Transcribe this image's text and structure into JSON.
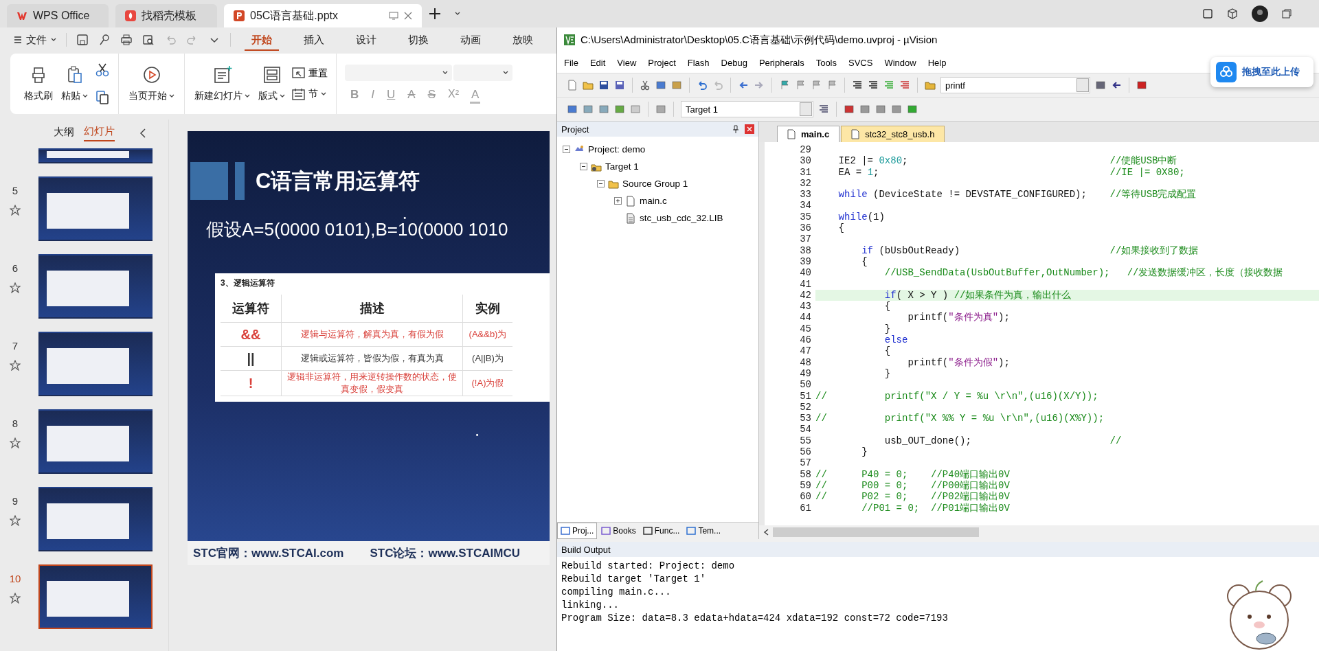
{
  "wps": {
    "tabs": [
      {
        "label": "WPS Office",
        "kind": "home",
        "selected": false
      },
      {
        "label": "找稻壳模板",
        "kind": "template",
        "selected": false
      },
      {
        "label": "05C语言基础.pptx",
        "kind": "presentation",
        "selected": true
      }
    ],
    "file_menu": "文件",
    "ribbon_tabs": [
      {
        "label": "开始",
        "selected": true
      },
      {
        "label": "插入",
        "selected": false
      },
      {
        "label": "设计",
        "selected": false
      },
      {
        "label": "切换",
        "selected": false
      },
      {
        "label": "动画",
        "selected": false
      },
      {
        "label": "放映",
        "selected": false
      }
    ],
    "ribbon": {
      "format_painter": "格式刷",
      "paste": "粘贴",
      "play_current": "当页开始",
      "new_slide": "新建幻灯片",
      "layout": "版式",
      "reset": "重置",
      "section": "节"
    },
    "format_buttons": [
      {
        "label": "B",
        "kind": "bold"
      },
      {
        "label": "I",
        "kind": "italic"
      },
      {
        "label": "U",
        "kind": "underline"
      },
      {
        "label": "A",
        "kind": "strike"
      },
      {
        "label": "S",
        "kind": "double-strike"
      },
      {
        "label": "X²",
        "kind": "superscript"
      },
      {
        "label": "A",
        "kind": "font-color"
      }
    ],
    "panel_tabs": [
      {
        "label": "大纲",
        "selected": false
      },
      {
        "label": "幻灯片",
        "selected": true
      }
    ],
    "thumbnails": [
      {
        "kind": "cut",
        "selected": false
      },
      {
        "kind": "full",
        "number": "5",
        "selected": false
      },
      {
        "kind": "full",
        "number": "6",
        "selected": false
      },
      {
        "kind": "full",
        "number": "7",
        "selected": false
      },
      {
        "kind": "full",
        "number": "8",
        "selected": false
      },
      {
        "kind": "full",
        "number": "9",
        "selected": false
      },
      {
        "kind": "full",
        "number": "10",
        "selected": true
      }
    ],
    "slide": {
      "title": "C语言常用运算符",
      "assumption": "假设A=5(0000 0101),B=10(0000 1010",
      "table_caption": "3、逻辑运算符",
      "columns": [
        "运算符",
        "描述",
        "实例"
      ],
      "rows": [
        {
          "operator": "&&",
          "description": "逻辑与运算符，解真为真，有假为假",
          "example": "(A&&b)为",
          "color": "#d9403a"
        },
        {
          "operator": "||",
          "description": "逻辑或运算符，皆假为假，有真为真",
          "example": "(A||B)为",
          "color": "#333333"
        },
        {
          "operator": "!",
          "description": "逻辑非运算符，用来逆转操作数的状态，使真变假，假变真",
          "example": "(!A)为假",
          "color": "#d9403a"
        }
      ],
      "footer": [
        "STC官网：www.STCAI.com",
        "STC论坛：www.STCAIMCU"
      ]
    }
  },
  "uvision": {
    "title": "C:\\Users\\Administrator\\Desktop\\05.C语言基础\\示例代码\\demo.uvproj - µVision",
    "menu": [
      "File",
      "Edit",
      "View",
      "Project",
      "Flash",
      "Debug",
      "Peripherals",
      "Tools",
      "SVCS",
      "Window",
      "Help"
    ],
    "find_combo": "printf",
    "target_combo": "Target 1",
    "project_title": "Project",
    "tree": [
      {
        "label": "Project: demo",
        "kind": "project",
        "expanded": true,
        "children": [
          {
            "label": "Target 1",
            "kind": "target",
            "expanded": true,
            "children": [
              {
                "label": "Source Group 1",
                "kind": "group",
                "expanded": true,
                "children": [
                  {
                    "label": "main.c",
                    "kind": "file",
                    "expanded": false
                  },
                  {
                    "label": "stc_usb_cdc_32.LIB",
                    "kind": "lib"
                  }
                ]
              }
            ]
          }
        ]
      }
    ],
    "panel_tabs": [
      {
        "label": "Proj...",
        "kind": "project",
        "selected": true
      },
      {
        "label": "Books",
        "kind": "books",
        "selected": false
      },
      {
        "label": "Func...",
        "kind": "functions",
        "selected": false
      },
      {
        "label": "Tem...",
        "kind": "templates",
        "selected": false
      }
    ],
    "file_tabs": [
      {
        "label": "main.c",
        "selected": true
      },
      {
        "label": "stc32_stc8_usb.h",
        "selected": false
      }
    ],
    "code": [
      {
        "num": "29",
        "current": false
      },
      {
        "num": "30",
        "current": false,
        "segs": [
          {
            "kind": "plain",
            "text": "    IE2 |= "
          },
          {
            "kind": "number",
            "text": "0x80"
          },
          {
            "kind": "plain",
            "text": ";                                   "
          },
          {
            "kind": "comment",
            "text": "//使能USB中断"
          }
        ]
      },
      {
        "num": "31",
        "current": false,
        "segs": [
          {
            "kind": "plain",
            "text": "    EA = "
          },
          {
            "kind": "number",
            "text": "1"
          },
          {
            "kind": "plain",
            "text": ";                                        "
          },
          {
            "kind": "comment",
            "text": "//IE |= 0X80;"
          }
        ]
      },
      {
        "num": "32",
        "current": false
      },
      {
        "num": "33",
        "current": false,
        "segs": [
          {
            "kind": "keyword",
            "text": "    while"
          },
          {
            "kind": "plain",
            "text": " (DeviceState != DEVSTATE_CONFIGURED);    "
          },
          {
            "kind": "comment",
            "text": "//等待USB完成配置"
          }
        ]
      },
      {
        "num": "34",
        "current": false
      },
      {
        "num": "35",
        "current": false,
        "segs": [
          {
            "kind": "keyword",
            "text": "    while"
          },
          {
            "kind": "plain",
            "text": "(1)"
          }
        ]
      },
      {
        "num": "36",
        "current": false,
        "segs": [
          {
            "kind": "plain",
            "text": "    {"
          }
        ]
      },
      {
        "num": "37",
        "current": false
      },
      {
        "num": "38",
        "current": false,
        "segs": [
          {
            "kind": "keyword",
            "text": "        if"
          },
          {
            "kind": "plain",
            "text": " (bUsbOutReady)                          "
          },
          {
            "kind": "comment",
            "text": "//如果接收到了数据"
          }
        ]
      },
      {
        "num": "39",
        "current": false,
        "segs": [
          {
            "kind": "plain",
            "text": "        {"
          }
        ]
      },
      {
        "num": "40",
        "current": false,
        "segs": [
          {
            "kind": "comment",
            "text": "            //USB_SendData(UsbOutBuffer,OutNumber);   //发送数据缓冲区，长度（接收数据"
          }
        ]
      },
      {
        "num": "41",
        "current": false
      },
      {
        "num": "42",
        "current": true,
        "segs": [
          {
            "kind": "keyword",
            "text": "            if"
          },
          {
            "kind": "plain",
            "text": "( X > Y ) "
          },
          {
            "kind": "comment",
            "text": "//如果条件为真，输出什么"
          }
        ]
      },
      {
        "num": "43",
        "current": false,
        "segs": [
          {
            "kind": "plain",
            "text": "            {"
          }
        ]
      },
      {
        "num": "44",
        "current": false,
        "segs": [
          {
            "kind": "plain",
            "text": "                printf("
          },
          {
            "kind": "string",
            "text": "\"条件为真\""
          },
          {
            "kind": "plain",
            "text": ");"
          }
        ]
      },
      {
        "num": "45",
        "current": false,
        "segs": [
          {
            "kind": "plain",
            "text": "            }"
          }
        ]
      },
      {
        "num": "46",
        "current": false,
        "segs": [
          {
            "kind": "keyword",
            "text": "            else"
          }
        ]
      },
      {
        "num": "47",
        "current": false,
        "segs": [
          {
            "kind": "plain",
            "text": "            {"
          }
        ]
      },
      {
        "num": "48",
        "current": false,
        "segs": [
          {
            "kind": "plain",
            "text": "                printf("
          },
          {
            "kind": "string",
            "text": "\"条件为假\""
          },
          {
            "kind": "plain",
            "text": ");"
          }
        ]
      },
      {
        "num": "49",
        "current": false,
        "segs": [
          {
            "kind": "plain",
            "text": "            }"
          }
        ]
      },
      {
        "num": "50",
        "current": false
      },
      {
        "num": "51",
        "current": false,
        "segs": [
          {
            "kind": "comment",
            "text": "//          printf(\"X / Y = %u \\r\\n\",(u16)(X/Y));"
          }
        ]
      },
      {
        "num": "52",
        "current": false
      },
      {
        "num": "53",
        "current": false,
        "segs": [
          {
            "kind": "comment",
            "text": "//          printf(\"X %% Y = %u \\r\\n\",(u16)(X%Y));"
          }
        ]
      },
      {
        "num": "54",
        "current": false
      },
      {
        "num": "55",
        "current": false,
        "segs": [
          {
            "kind": "plain",
            "text": "            usb_OUT_done();                        "
          },
          {
            "kind": "comment",
            "text": "//"
          }
        ]
      },
      {
        "num": "56",
        "current": false,
        "segs": [
          {
            "kind": "plain",
            "text": "        }"
          }
        ]
      },
      {
        "num": "57",
        "current": false
      },
      {
        "num": "58",
        "current": false,
        "segs": [
          {
            "kind": "comment",
            "text": "//      P40 = 0;    //P40端口输出0V"
          }
        ]
      },
      {
        "num": "59",
        "current": false,
        "segs": [
          {
            "kind": "comment",
            "text": "//      P00 = 0;    //P00端口输出0V"
          }
        ]
      },
      {
        "num": "60",
        "current": false,
        "segs": [
          {
            "kind": "comment",
            "text": "//      P02 = 0;    //P02端口输出0V"
          }
        ]
      },
      {
        "num": "61",
        "current": false,
        "segs": [
          {
            "kind": "comment",
            "text": "        //P01 = 0;  //P01端口输出0V"
          }
        ]
      }
    ],
    "build_title": "Build Output",
    "build_lines": [
      "Rebuild started: Project: demo",
      "Rebuild target 'Target 1'",
      "compiling main.c...",
      "linking...",
      "Program Size: data=8.3 edata+hdata=424 xdata=192 const=72 code=7193"
    ]
  },
  "upload_button": "拖拽至此上传"
}
